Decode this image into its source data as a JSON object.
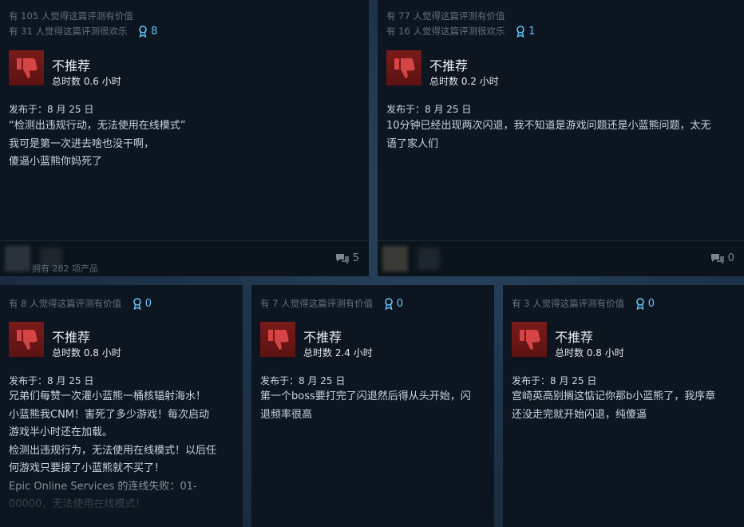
{
  "reviews": [
    {
      "helpful": "有 105 人觉得这篇评测有价值",
      "funny": "有 31 人觉得这篇评测很欢乐",
      "awards": "8",
      "verdict": "不推荐",
      "hours": "总时数 0.6 小时",
      "posted": "发布于：8 月 25 日",
      "lines": [
        "“检测出违规行动，无法使用在线模式”",
        "我可是第一次进去啥也没干啊，",
        "傻逼小蓝熊你妈死了"
      ],
      "comments": "5",
      "owns": "拥有 282 项产品"
    },
    {
      "helpful": "有 77 人觉得这篇评测有价值",
      "funny": "有 16 人觉得这篇评测很欢乐",
      "awards": "1",
      "verdict": "不推荐",
      "hours": "总时数 0.2 小时",
      "posted": "发布于：8 月 25 日",
      "lines": [
        "10分钟已经出现两次闪退，我不知道是游戏问题还是小蓝熊问题，太无",
        "语了家人们"
      ],
      "comments": "0"
    },
    {
      "helpful": "有 8 人觉得这篇评测有价值",
      "awards": "0",
      "verdict": "不推荐",
      "hours": "总时数 0.8 小时",
      "posted": "发布于：8 月 25 日",
      "lines": [
        "兄弟们每赞一次灌小蓝熊一桶核辐射海水！",
        "小蓝熊我CNM！害死了多少游戏！每次启动",
        "游戏半小时还在加载。",
        "检测出违规行为，无法使用在线模式！以后任",
        "何游戏只要接了小蓝熊就不买了！",
        "Epic Online Services 的连线失败：01-",
        "00000，无法使用在线模式！"
      ]
    },
    {
      "helpful": "有 7 人觉得这篇评测有价值",
      "awards": "0",
      "verdict": "不推荐",
      "hours": "总时数 2.4 小时",
      "posted": "发布于：8 月 25 日",
      "lines": [
        "第一个boss要打完了闪退然后得从头开始，闪",
        "退频率很高"
      ]
    },
    {
      "helpful": "有 3 人觉得这篇评测有价值",
      "awards": "0",
      "verdict": "不推荐",
      "hours": "总时数 0.8 小时",
      "posted": "发布于：8 月 25 日",
      "lines": [
        "宫崎英高别搁这惦记你那b小蓝熊了，我序章",
        "还没走完就开始闪退，纯傻逼"
      ]
    }
  ],
  "colors": {
    "card_bg": "#0d1620",
    "award": "#66c0f4",
    "thumb_red": "#7a1a1a",
    "muted": "#626f7b"
  },
  "icons": {
    "thumb": "thumbs-down-icon",
    "award": "award-ribbon-icon",
    "comment": "comment-bubbles-icon"
  }
}
